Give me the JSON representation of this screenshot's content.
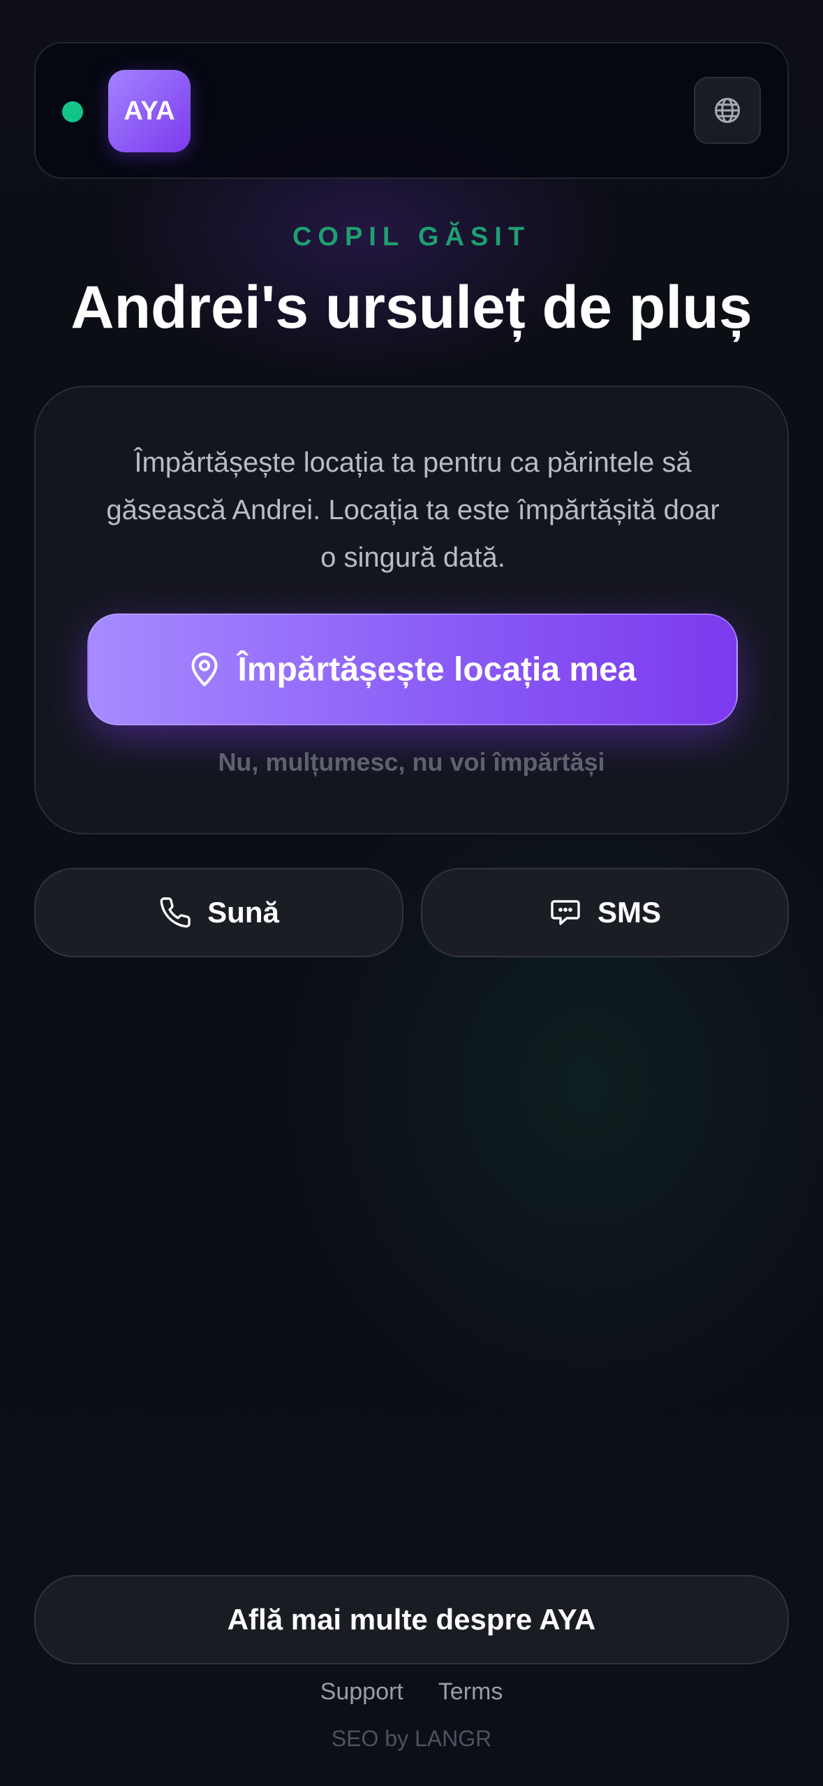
{
  "header": {
    "logo_text": "AYA",
    "status_color": "#12c48a",
    "language_icon": "globe-icon"
  },
  "hero": {
    "eyebrow": "COPIL GĂSIT",
    "title": "Andrei's ursuleț de pluș"
  },
  "card": {
    "description": "Împărtășește locația ta pentru ca părintele să găsească Andrei. Locația ta este împărtășită doar o singură dată.",
    "share_button_label": "Împărtășește locația mea",
    "share_button_icon": "location-pin-icon",
    "decline_label": "Nu, mulțumesc, nu voi împărtăși"
  },
  "contact": {
    "call_label": "Sună",
    "call_icon": "phone-icon",
    "sms_label": "SMS",
    "sms_icon": "chat-bubble-icon"
  },
  "footer": {
    "learn_more_label": "Află mai multe despre AYA",
    "support_label": "Support",
    "terms_label": "Terms",
    "credit": "SEO by LANGR"
  },
  "colors": {
    "accent": "#7c3aed",
    "accent_light": "#a68bff",
    "success": "#1f9e72",
    "background": "#0b0e15"
  }
}
